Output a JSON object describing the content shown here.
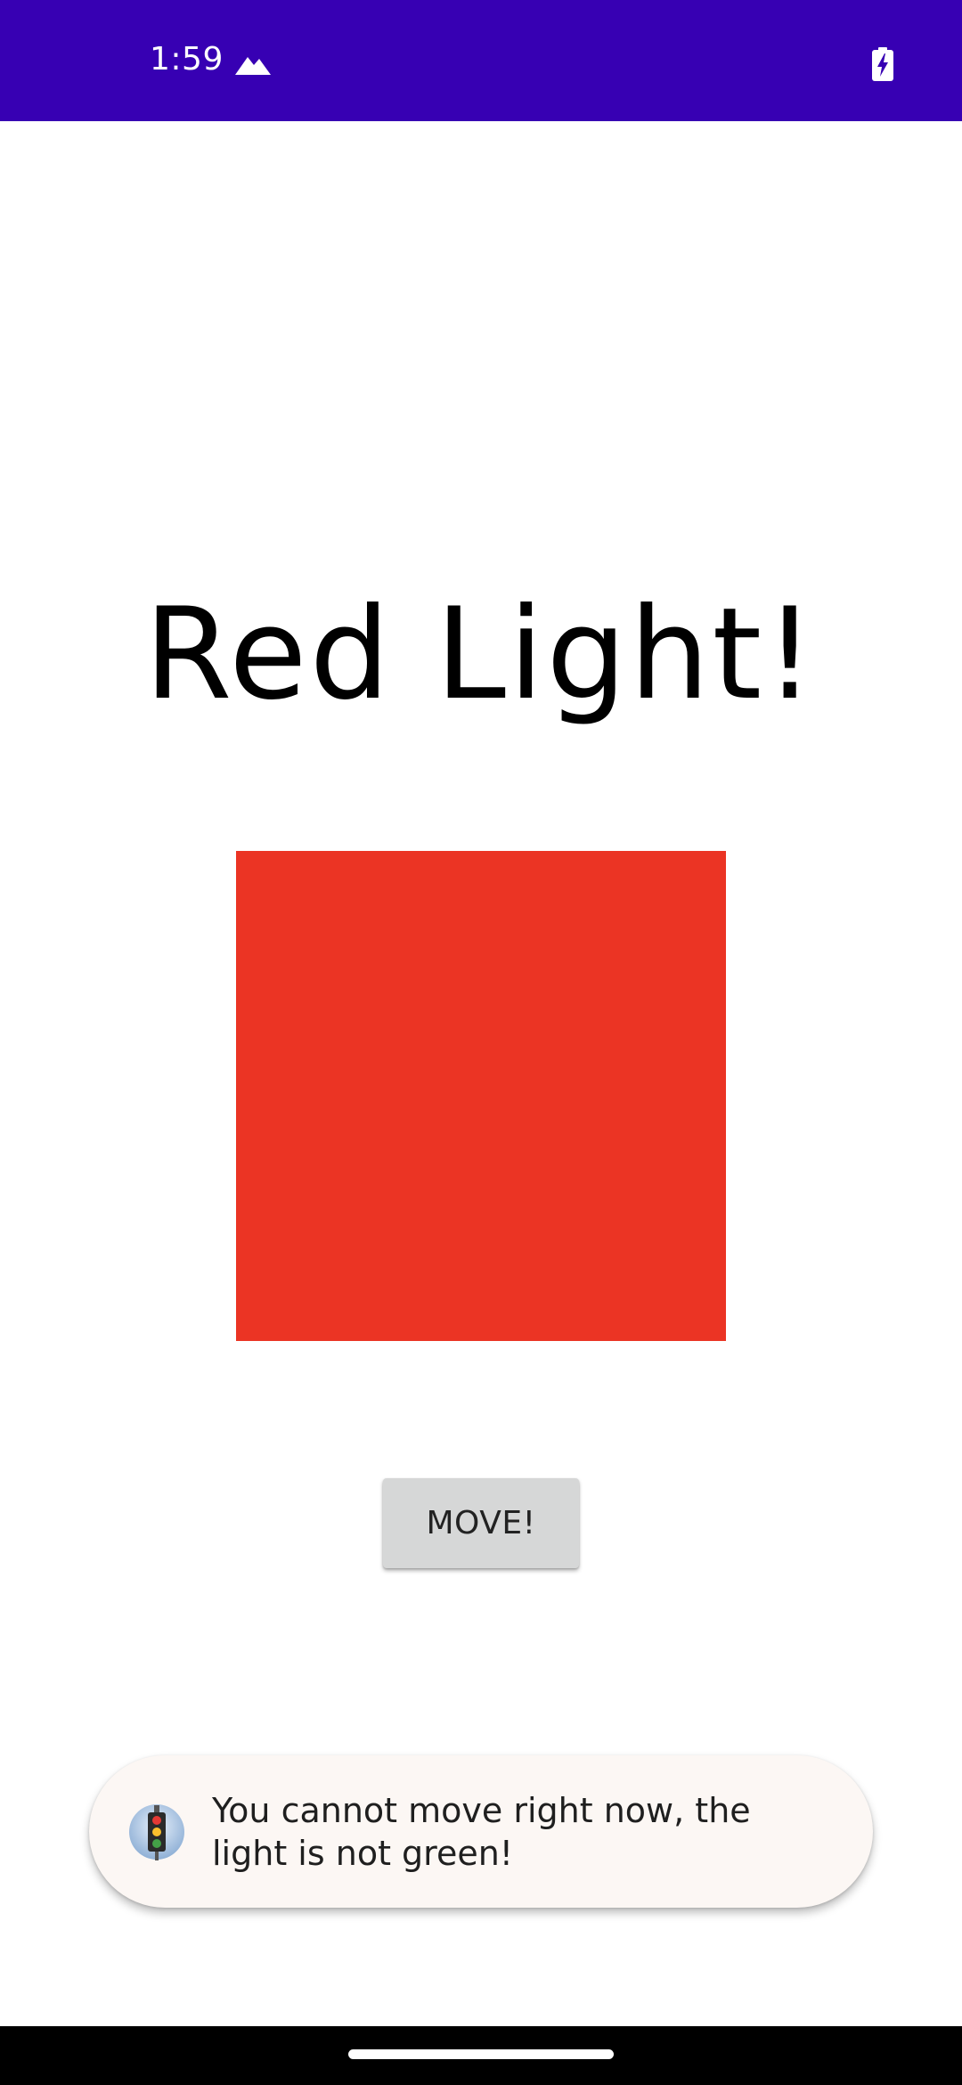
{
  "status_bar": {
    "time": "1:59",
    "background_color": "#3700b3",
    "icons": [
      "mountain-icon",
      "battery-charging-icon"
    ]
  },
  "main": {
    "title": "Red Light!",
    "light_color": "#eb3424",
    "move_button_label": "MOVE!"
  },
  "toast": {
    "icon": "traffic-light-icon",
    "message": "You cannot move right now, the light is not green!"
  },
  "nav_bar": {
    "handle": "home-handle"
  }
}
